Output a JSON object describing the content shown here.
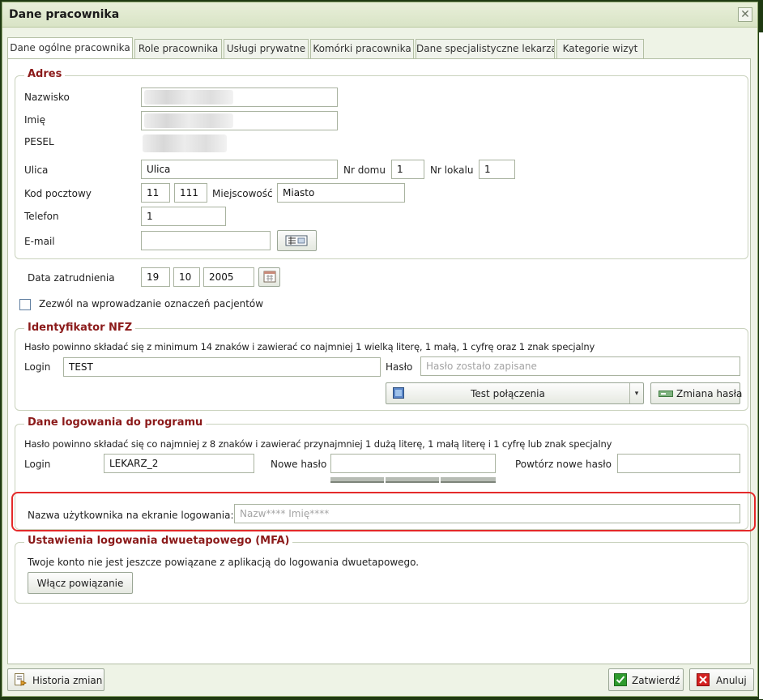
{
  "window": {
    "title": "Dane pracownika"
  },
  "tabs": [
    {
      "label": "Dane ogólne pracownika",
      "active": true
    },
    {
      "label": "Role pracownika"
    },
    {
      "label": "Usługi prywatne"
    },
    {
      "label": "Komórki pracownika"
    },
    {
      "label": "Dane specjalistyczne lekarza"
    },
    {
      "label": "Kategorie wizyt"
    }
  ],
  "address": {
    "legend": "Adres",
    "surname_label": "Nazwisko",
    "firstname_label": "Imię",
    "pesel_label": "PESEL",
    "street_label": "Ulica",
    "street_value": "Ulica",
    "house_label": "Nr domu",
    "house_value": "1",
    "flat_label": "Nr lokalu",
    "flat_value": "1",
    "zip_label": "Kod pocztowy",
    "zip_part1": "11",
    "zip_part2": "111",
    "city_label": "Miejscowość",
    "city_value": "Miasto",
    "phone_label": "Telefon",
    "phone_value": "1",
    "email_label": "E-mail",
    "email_value": ""
  },
  "employment": {
    "label": "Data zatrudnienia",
    "day": "19",
    "month": "10",
    "year": "2005"
  },
  "marking_checkbox": {
    "label": "Zezwól na wprowadzanie oznaczeń pacjentów",
    "checked": false
  },
  "nfz": {
    "legend": "Identyfikator NFZ",
    "hint": "Hasło powinno składać się z minimum 14 znaków i zawierać co najmniej 1 wielką literę, 1 małą, 1 cyfrę oraz 1 znak specjalny",
    "login_label": "Login",
    "login_value": "TEST",
    "password_label": "Hasło",
    "password_placeholder": "Hasło zostało zapisane",
    "test_button": "Test połączenia",
    "change_password_button": "Zmiana hasła"
  },
  "program_login": {
    "legend": "Dane logowania do programu",
    "hint": "Hasło powinno składać się co najmniej z 8 znaków i zawierać przynajmniej 1 dużą literę, 1 małą literę i 1 cyfrę lub znak specjalny",
    "login_label": "Login",
    "login_value": "LEKARZ_2",
    "new_password_label": "Nowe hasło",
    "repeat_password_label": "Powtórz nowe hasło",
    "display_name_label": "Nazwa użytkownika na ekranie logowania:",
    "display_name_value": "Nazw**** Imię****"
  },
  "mfa": {
    "legend": "Ustawienia logowania dwuetapowego (MFA)",
    "status_text": "Twoje konto nie jest jeszcze powiązane z aplikacją do logowania dwuetapowego.",
    "link_button": "Włącz powiązanie"
  },
  "footer": {
    "history_button": "Historia zmian",
    "confirm_button": "Zatwierdź",
    "cancel_button": "Anuluj"
  },
  "colors": {
    "legend": "#8b1a1a",
    "highlight": "#e42a2a",
    "title_bar": "#dde7cc",
    "confirm_icon": "#2e9a2e",
    "cancel_icon": "#d42020"
  },
  "icons": {
    "close": "close-icon",
    "email_picker": "address-book-icon",
    "calendar": "calendar-icon",
    "test_connection": "network-icon",
    "change_password": "key-icon",
    "history": "history-icon",
    "confirm": "check-icon",
    "cancel": "x-icon"
  }
}
